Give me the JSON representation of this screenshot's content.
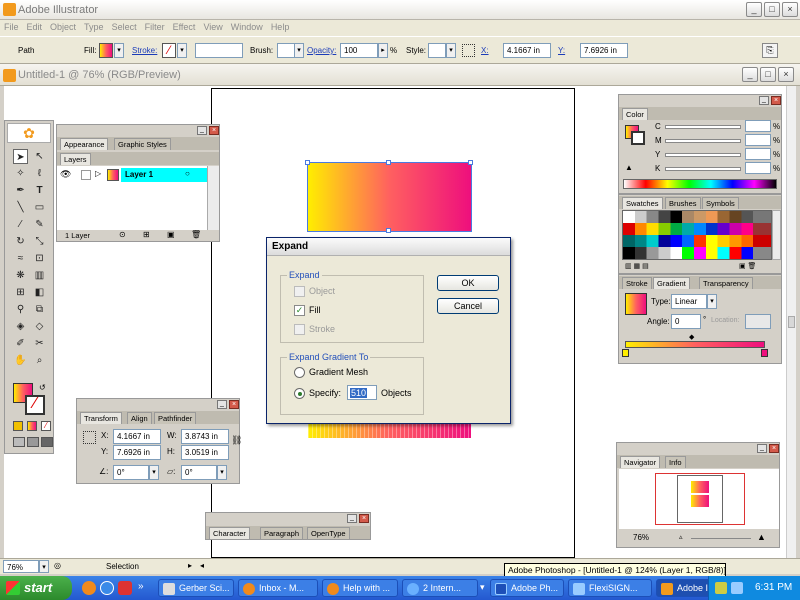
{
  "app": {
    "title": "Adobe Illustrator",
    "doc_title": "Untitled-1 @ 76% (RGB/Preview)"
  },
  "menu": [
    "File",
    "Edit",
    "Object",
    "Type",
    "Select",
    "Filter",
    "Effect",
    "View",
    "Window",
    "Help"
  ],
  "control_bar": {
    "path": "Path",
    "fill": "Fill:",
    "stroke": "Stroke:",
    "brush": "Brush:",
    "opacity_label": "Opacity:",
    "opacity_value": "100",
    "percent": "%",
    "style": "Style:",
    "x_label": "X:",
    "x_value": "4.1667 in",
    "y_label": "Y:",
    "y_value": "7.6926 in"
  },
  "appearance_panel": {
    "tabs": [
      "Appearance",
      "Graphic Styles"
    ],
    "layers_tab": "Layers",
    "layer_name": "Layer 1",
    "layer_count": "1 Layer"
  },
  "transform_panel": {
    "tabs": [
      "Transform",
      "Align",
      "Pathfinder"
    ],
    "x_label": "X:",
    "x": "4.1667 in",
    "y_label": "Y:",
    "y": "7.6926 in",
    "w_label": "W:",
    "w": "3.8743 in",
    "h_label": "H:",
    "h": "3.0519 in",
    "rotate": "0°",
    "shear": "0°"
  },
  "character_panel": {
    "tabs": [
      "Character",
      "Paragraph",
      "OpenType"
    ]
  },
  "color_panel": {
    "tab": "Color",
    "labels": [
      "C",
      "M",
      "Y",
      "K"
    ],
    "pct": "%"
  },
  "swatches_panel": {
    "tabs": [
      "Swatches",
      "Brushes",
      "Symbols"
    ]
  },
  "gradient_panel": {
    "tabs": [
      "Stroke",
      "Gradient",
      "Transparency"
    ],
    "type_label": "Type:",
    "type_value": "Linear",
    "angle_label": "Angle:",
    "angle_value": "0",
    "degree": "°",
    "location_label": "Location:"
  },
  "navigator_panel": {
    "tabs": [
      "Navigator",
      "Info"
    ],
    "zoom": "76%"
  },
  "dialog": {
    "title": "Expand",
    "expand_label": "Expand",
    "object": "Object",
    "fill": "Fill",
    "stroke": "Stroke",
    "gradient_label": "Expand Gradient To",
    "gradient_mesh": "Gradient Mesh",
    "specify": "Specify:",
    "specify_value": "510",
    "objects": "Objects",
    "ok": "OK",
    "cancel": "Cancel"
  },
  "status": {
    "zoom": "76%",
    "mode": "Selection"
  },
  "tooltip": "Adobe Photoshop - [Untitled-1 @ 124% (Layer 1, RGB/8)]",
  "taskbar": {
    "start": "start",
    "buttons": [
      "Gerber Sci...",
      "Inbox - M...",
      "Help with ...",
      "2 Intern...",
      "Adobe Ph...",
      "FlexiSIGN...",
      "Adobe Illu..."
    ],
    "time": "6:31 PM"
  },
  "colors": {
    "grad_start": "#ffee00",
    "grad_mid": "#ff6060",
    "grad_end": "#ee0f7d",
    "layer_row": "#00ffff",
    "dialog_title_accent": "#2350ba"
  }
}
